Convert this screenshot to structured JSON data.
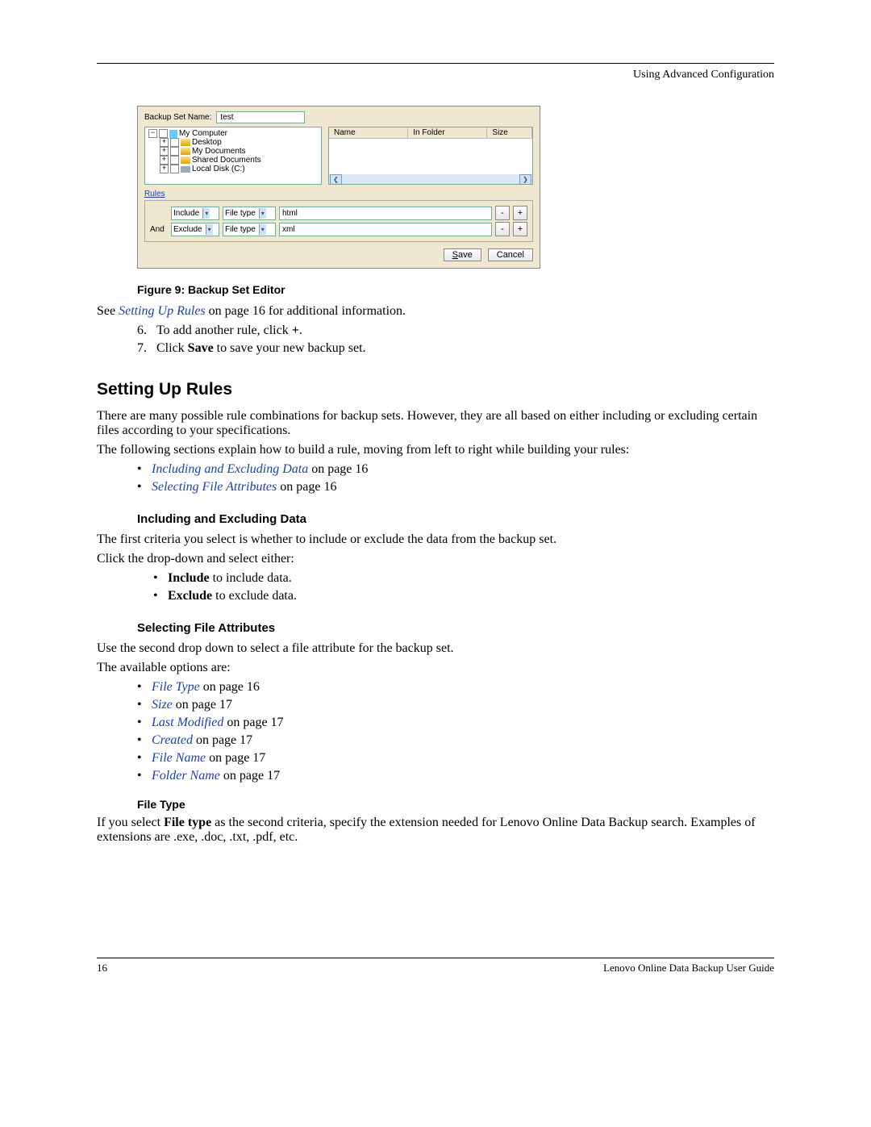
{
  "header": {
    "right": "Using Advanced Configuration"
  },
  "screenshot": {
    "name_label": "Backup Set Name:",
    "name_value": "test",
    "tree": {
      "root": "My Computer",
      "children": [
        "Desktop",
        "My Documents",
        "Shared Documents",
        "Local Disk (C:)"
      ]
    },
    "list_headers": [
      "Name",
      "In Folder",
      "Size"
    ],
    "rules_label": "Rules",
    "rules": [
      {
        "prefix": "",
        "op": "Include",
        "attr": "File type",
        "value": "html"
      },
      {
        "prefix": "And",
        "op": "Exclude",
        "attr": "File type",
        "value": "xml"
      }
    ],
    "buttons": {
      "save": "Save",
      "cancel": "Cancel",
      "minus": "-",
      "plus": "+"
    }
  },
  "caption": "Figure 9: Backup Set Editor",
  "see_line": {
    "pre": "See ",
    "link": "Setting Up Rules",
    "post": " on page 16 for additional information."
  },
  "steps": [
    {
      "n": "6.",
      "pre": "To add another rule, click ",
      "bold": "+",
      "post": "."
    },
    {
      "n": "7.",
      "pre": "Click ",
      "bold": "Save",
      "post": " to save your new backup set."
    }
  ],
  "section_title": "Setting Up Rules",
  "section_p1": "There are many possible rule combinations for backup sets. However, they are all based on either including or excluding certain files according to your specifications.",
  "section_p2": "The following sections explain how to build a rule, moving from left to right while building your rules:",
  "section_bullets": [
    {
      "link": "Including and Excluding Data",
      "post": " on page 16"
    },
    {
      "link": "Selecting File Attributes",
      "post": " on page 16"
    }
  ],
  "inc_excl_title": "Including and Excluding Data",
  "inc_excl_p1": "The first criteria you select is whether to include or exclude the data from the backup set.",
  "inc_excl_p2": "Click the drop-down and select either:",
  "inc_excl_bullets": [
    {
      "bold": "Include",
      "post": " to include data."
    },
    {
      "bold": "Exclude",
      "post": " to exclude data."
    }
  ],
  "sel_attr_title": "Selecting File Attributes",
  "sel_attr_p1": "Use the second drop down to select a file attribute for the backup set.",
  "sel_attr_p2": "The available options are:",
  "attr_bullets": [
    {
      "link": "File Type",
      "post": " on page 16"
    },
    {
      "link": "Size",
      "post": " on page 17"
    },
    {
      "link": "Last Modified",
      "post": " on page 17"
    },
    {
      "link": "Created",
      "post": " on page 17"
    },
    {
      "link": "File Name",
      "post": " on page 17"
    },
    {
      "link": "Folder Name",
      "post": " on page 17"
    }
  ],
  "filetype_title": "File Type",
  "filetype_p": {
    "pre": "If you select ",
    "bold": "File type",
    "post": " as the second criteria, specify the extension needed for Lenovo Online Data Backup search. Examples of extensions are .exe, .doc, .txt, .pdf, etc."
  },
  "footer": {
    "page": "16",
    "title": "Lenovo Online Data Backup User Guide"
  }
}
